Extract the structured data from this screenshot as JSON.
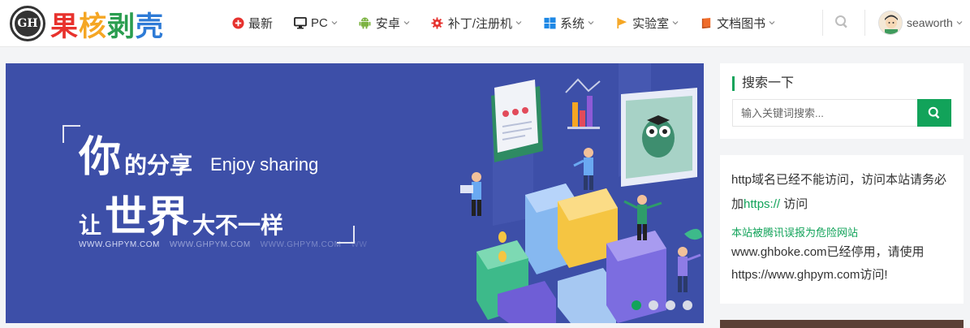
{
  "logo": {
    "badge_text": "GH",
    "chars": [
      "果",
      "核",
      "剥",
      "壳"
    ]
  },
  "nav": [
    {
      "label": "最新",
      "icon": "plus-circle-icon",
      "dropdown": false
    },
    {
      "label": "PC",
      "icon": "monitor-icon",
      "dropdown": true
    },
    {
      "label": "安卓",
      "icon": "android-icon",
      "dropdown": true
    },
    {
      "label": "补丁/注册机",
      "icon": "gear-icon",
      "dropdown": true
    },
    {
      "label": "系统",
      "icon": "windows-icon",
      "dropdown": true
    },
    {
      "label": "实验室",
      "icon": "flag-icon",
      "dropdown": true
    },
    {
      "label": "文档图书",
      "icon": "book-icon",
      "dropdown": true
    }
  ],
  "user": {
    "name": "seaworth"
  },
  "banner": {
    "big1": "你",
    "mid1": "的分享",
    "english": "Enjoy sharing",
    "small2": "让",
    "big2": "世界",
    "mid2": "大不一样",
    "urls": [
      "WWW.GHPYM.COM",
      "WWW.GHPYM.COM",
      "WWW.GHPYM.COM",
      "WW"
    ],
    "slides": 4,
    "active_slide": 1
  },
  "sidebar": {
    "search_title": "搜索一下",
    "search_placeholder": "输入关键词搜索...",
    "notice_part1": "http域名已经不能访问，访问本站请务必加",
    "notice_https": "https://",
    "notice_part2": " 访问",
    "notice_warning": "本站被腾讯误报为危险网站",
    "notice_change": "www.ghboke.com已经停用，请使用https://www.ghpym.com访问!"
  },
  "colors": {
    "accent": "#12a35a",
    "banner_bg": "#3d4fa8"
  }
}
